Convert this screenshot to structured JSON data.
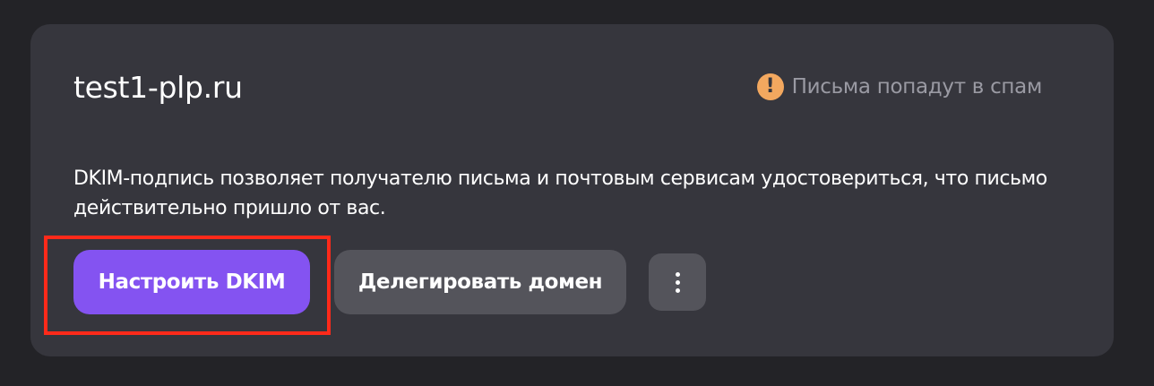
{
  "card": {
    "domain": "test1-plp.ru",
    "warning": {
      "icon": "warning-icon",
      "text": "Письма попадут в спам",
      "color": "#f3a85f"
    },
    "description": "DKIM-подпись позволяет получателю письма и почтовым сервисам удостовериться, что письмо действительно пришло от вас.",
    "actions": {
      "setup_dkim": "Настроить DKIM",
      "delegate_domain": "Делегировать домен",
      "more_icon": "more-vertical-icon"
    }
  },
  "colors": {
    "background": "#232327",
    "card": "#36363d",
    "primary": "#8453f1",
    "secondary": "#54545b",
    "highlight": "#ff2a1a"
  }
}
